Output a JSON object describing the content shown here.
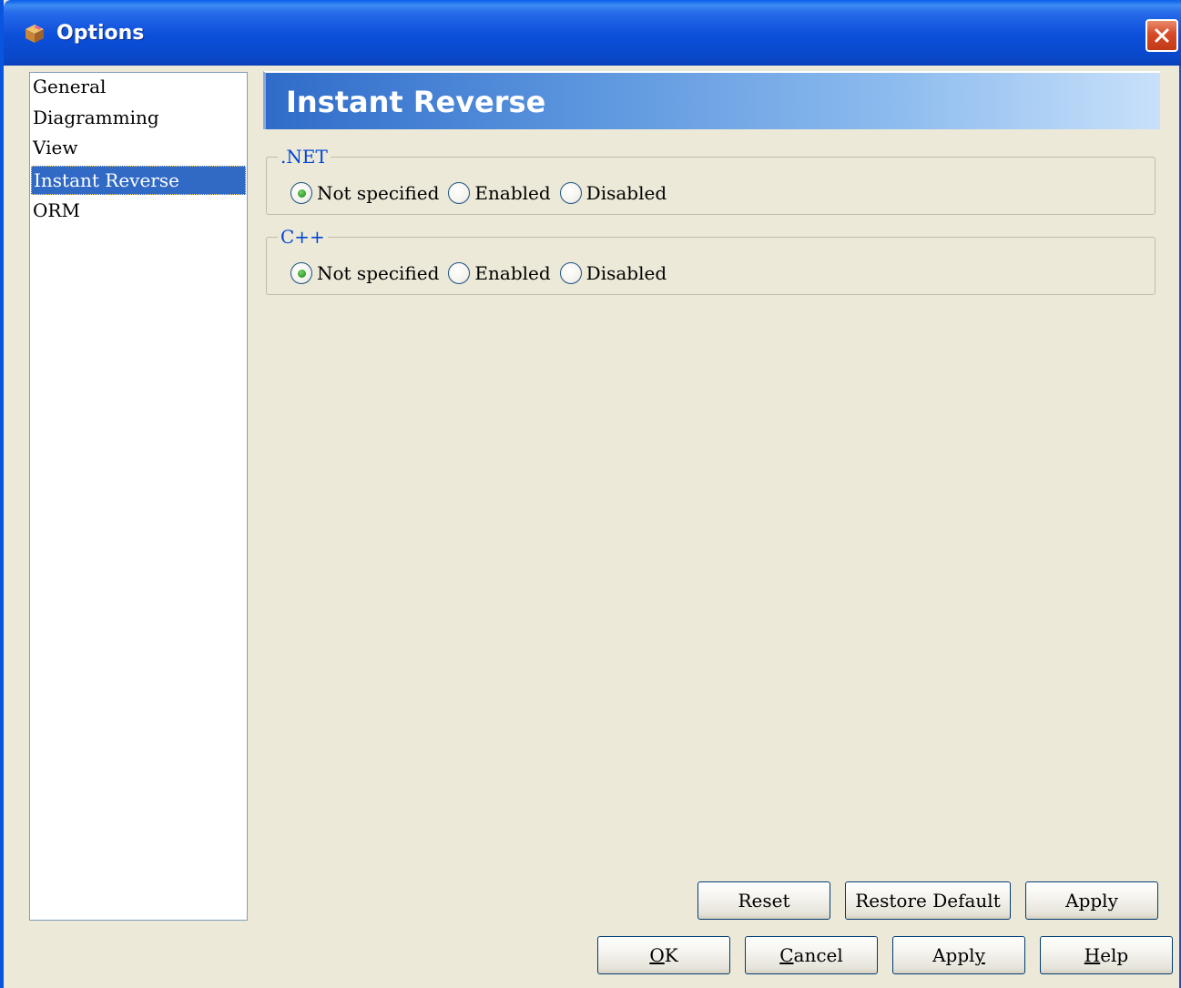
{
  "window": {
    "title": "Options",
    "icon": "app-cube-icon",
    "close_icon": "close-icon"
  },
  "nav": {
    "items": [
      {
        "label": "General",
        "selected": false
      },
      {
        "label": "Diagramming",
        "selected": false
      },
      {
        "label": "View",
        "selected": false
      },
      {
        "label": "Instant Reverse",
        "selected": true
      },
      {
        "label": "ORM",
        "selected": false
      }
    ]
  },
  "panel": {
    "title": "Instant Reverse",
    "groups": [
      {
        "legend": ".NET",
        "options": [
          "Not specified",
          "Enabled",
          "Disabled"
        ],
        "selected": "Not specified"
      },
      {
        "legend": "C++",
        "options": [
          "Not specified",
          "Enabled",
          "Disabled"
        ],
        "selected": "Not specified"
      }
    ]
  },
  "panel_buttons": {
    "reset": "Reset",
    "restore_default": "Restore Default",
    "apply": "Apply"
  },
  "dialog_buttons": {
    "ok": {
      "label": "OK",
      "mnemonic": "O",
      "rest": "K"
    },
    "cancel": {
      "label": "Cancel",
      "mnemonic": "C",
      "rest": "ancel"
    },
    "apply": {
      "label": "Apply",
      "mnemonic": "y",
      "rest": "Appl"
    },
    "help": {
      "label": "Help",
      "mnemonic": "H",
      "rest": "elp"
    }
  },
  "colors": {
    "title_bar": "#0a4fd9",
    "selection": "#316ac5",
    "legend_text": "#0046d5",
    "dialog_bg": "#ece9d8",
    "close_button": "#d84a26"
  }
}
